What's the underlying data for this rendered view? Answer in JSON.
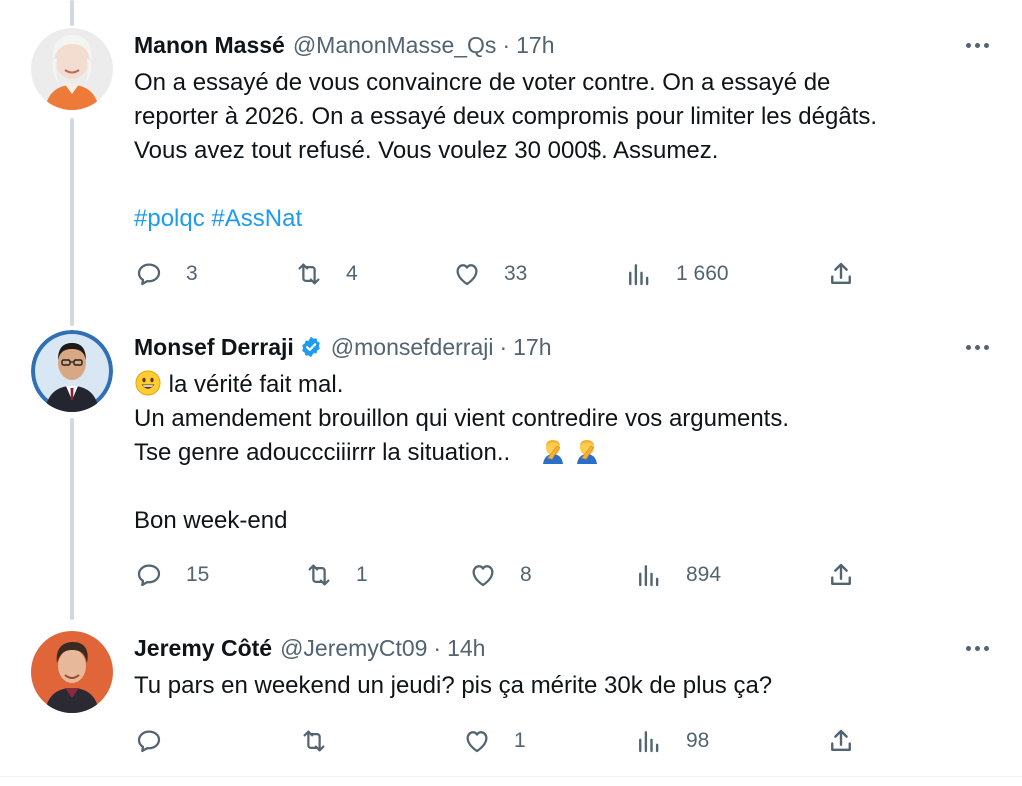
{
  "tweets": [
    {
      "name": "Manon Massé",
      "handle": "@ManonMasse_Qs",
      "separator": "·",
      "time": "17h",
      "verified": false,
      "lines": [
        "On a essayé de vous convaincre de voter contre. On a essayé de",
        "reporter à 2026. On a essayé deux compromis pour limiter les dégâts.",
        "Vous avez tout refusé. Vous voulez 30 000$. Assumez."
      ],
      "hashtags": [
        "#polqc",
        "#AssNat"
      ],
      "replies": "3",
      "retweets": "4",
      "likes": "33",
      "views": "1 660"
    },
    {
      "name": "Monsef Derraji",
      "handle": "@monsefderraji",
      "separator": "·",
      "time": "17h",
      "verified": true,
      "lines": [
        "la vérité fait mal.",
        "Un amendement brouillon qui vient contredire vos arguments.",
        "Tse genre adouccciiirrr la situation..",
        "Bon week-end"
      ],
      "replies": "15",
      "retweets": "1",
      "likes": "8",
      "views": "894"
    },
    {
      "name": "Jeremy Côté",
      "handle": "@JeremyCt09",
      "separator": "·",
      "time": "14h",
      "verified": false,
      "lines": [
        "Tu pars en weekend un jeudi? pis ça mérite 30k de plus ça?"
      ],
      "replies": "",
      "retweets": "",
      "likes": "1",
      "views": "98"
    }
  ],
  "icons": {
    "reply": "reply-icon",
    "retweet": "retweet-icon",
    "like": "like-icon",
    "views": "views-icon",
    "share": "share-icon",
    "more": "more-icon",
    "verified": "verified-badge-icon",
    "grin": "grinning-face-emoji",
    "facepalm": "facepalm-emoji"
  },
  "colors": {
    "text": "#0f1419",
    "secondary": "#536471",
    "link": "#1d9bf0",
    "thread_line": "#cfd9de"
  }
}
